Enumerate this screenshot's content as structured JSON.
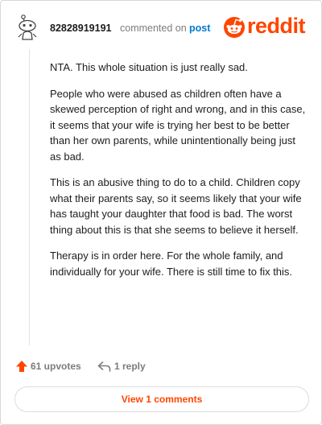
{
  "header": {
    "username": "82828919191",
    "commented_text": "commented on",
    "post_link": "post",
    "logo_text": "reddit"
  },
  "comment": {
    "paragraphs": [
      "NTA. This whole situation is just really sad.",
      "People who were abused as children often have a skewed perception of right and wrong, and in this case, it seems that your wife is trying her best to be better than her own parents, while unintentionally being just as bad.",
      "This is an abusive thing to do to a child. Children copy what their parents say, so it seems likely that your wife has taught your daughter that food is bad. The worst thing about this is that she seems to believe it herself.",
      "Therapy is in order here. For the whole family, and individually for your wife. There is still time to fix this."
    ]
  },
  "actions": {
    "upvotes_label": "61 upvotes",
    "reply_label": "1 reply",
    "view_comments_label": "View 1 comments"
  },
  "colors": {
    "brand": "#ff4500",
    "link": "#0079d3",
    "muted": "#7c7c7c"
  },
  "icons": {
    "avatar": "snoo-avatar-icon",
    "logo": "reddit-logo-icon",
    "upvote": "upvote-arrow-icon",
    "reply": "reply-arrow-icon"
  }
}
